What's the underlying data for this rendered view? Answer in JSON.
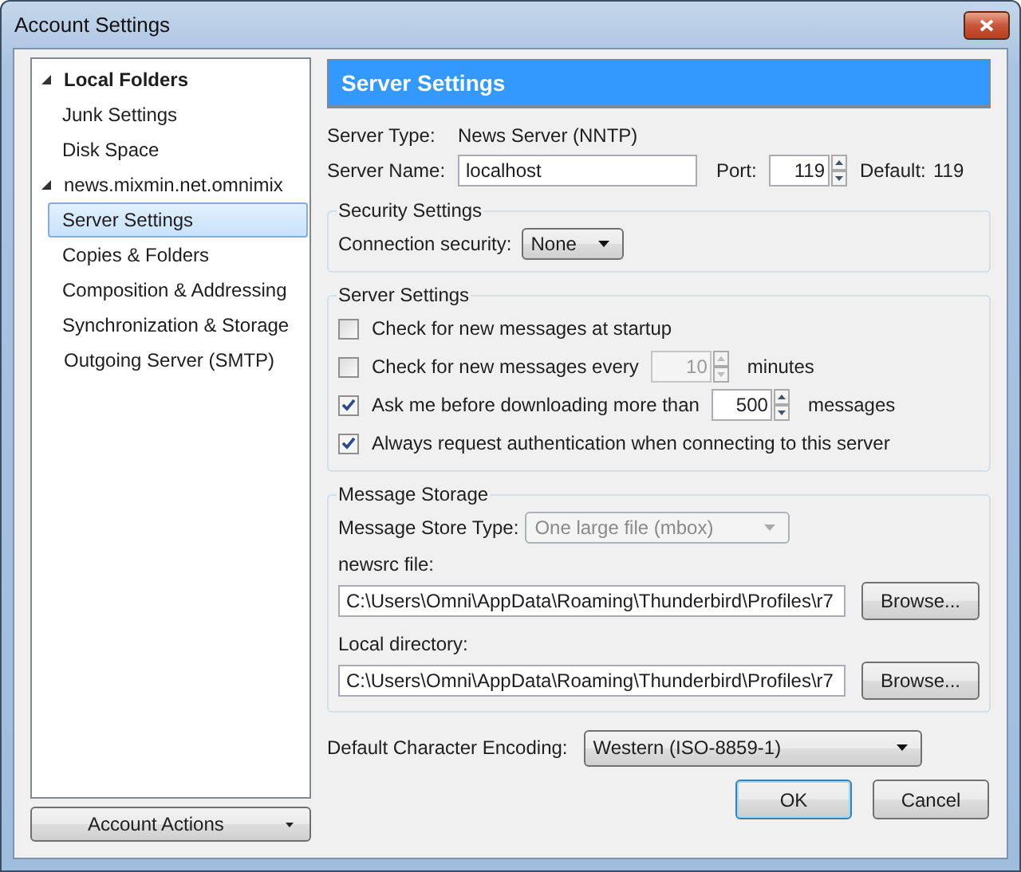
{
  "window": {
    "title": "Account Settings"
  },
  "tree": [
    {
      "label": "Local Folders",
      "bold": true,
      "expanded": true,
      "selected": false,
      "children": [
        {
          "label": "Junk Settings",
          "selected": false
        },
        {
          "label": "Disk Space",
          "selected": false
        }
      ]
    },
    {
      "label": "news.mixmin.net.omnimix",
      "bold": false,
      "expanded": true,
      "selected": false,
      "children": [
        {
          "label": "Server Settings",
          "selected": true
        },
        {
          "label": "Copies & Folders",
          "selected": false
        },
        {
          "label": "Composition & Addressing",
          "selected": false
        },
        {
          "label": "Synchronization & Storage",
          "selected": false
        }
      ]
    },
    {
      "label": "Outgoing Server (SMTP)",
      "bold": false,
      "selected": false
    }
  ],
  "account_actions": "Account Actions",
  "header": "Server Settings",
  "server_type": {
    "label": "Server Type:",
    "value": "News Server (NNTP)"
  },
  "server_name": {
    "label": "Server Name:",
    "value": "localhost"
  },
  "port": {
    "label": "Port:",
    "value": "119"
  },
  "default_port": {
    "label": "Default:",
    "value": "119"
  },
  "security": {
    "title": "Security Settings",
    "label": "Connection security:",
    "value": "None"
  },
  "server_settings": {
    "title": "Server Settings",
    "options": [
      {
        "kind": "checkbox",
        "label": "Check for new messages at startup",
        "checked": false
      },
      {
        "kind": "spin",
        "label": "Check for new messages every",
        "checked": false,
        "value": "10",
        "unit": "minutes",
        "disabled": true
      },
      {
        "kind": "spin",
        "label": "Ask me before downloading more than",
        "checked": true,
        "value": "500",
        "unit": "messages",
        "disabled": false
      },
      {
        "kind": "checkbox",
        "label": "Always request authentication when connecting to this server",
        "checked": true
      }
    ]
  },
  "storage": {
    "title": "Message Storage",
    "store_type": {
      "label": "Message Store Type:",
      "value": "One large file (mbox)",
      "disabled": true
    },
    "paths": [
      {
        "label": "newsrc file:",
        "value": "C:\\Users\\Omni\\AppData\\Roaming\\Thunderbird\\Profiles\\r7",
        "button": "Browse..."
      },
      {
        "label": "Local directory:",
        "value": "C:\\Users\\Omni\\AppData\\Roaming\\Thunderbird\\Profiles\\r7",
        "button": "Browse..."
      }
    ]
  },
  "encoding": {
    "label": "Default Character Encoding:",
    "value": "Western (ISO-8859-1)"
  },
  "buttons": [
    {
      "label": "OK",
      "default": true
    },
    {
      "label": "Cancel",
      "default": false
    }
  ]
}
